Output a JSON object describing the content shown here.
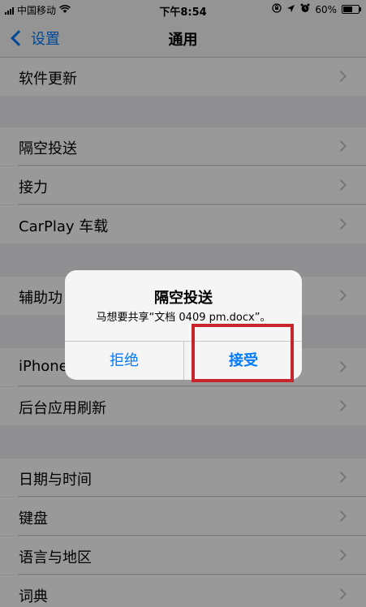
{
  "status_bar": {
    "carrier": "中国移动",
    "time": "下午8:54",
    "battery_percent": "60%",
    "battery_level": 0.6,
    "icons": [
      "signal-icon",
      "wifi-icon",
      "location-lock-icon",
      "location-icon",
      "alarm-icon",
      "battery-icon"
    ]
  },
  "nav": {
    "back_label": "设置",
    "title": "通用"
  },
  "settings": {
    "rows": [
      {
        "label": "软件更新"
      },
      {
        "label": "隔空投送"
      },
      {
        "label": "接力"
      },
      {
        "label": "CarPlay 车载"
      },
      {
        "label": "辅助功"
      },
      {
        "label": "iPhone"
      },
      {
        "label": "后台应用刷新"
      },
      {
        "label": "日期与时间"
      },
      {
        "label": "键盘"
      },
      {
        "label": "语言与地区"
      },
      {
        "label": "词典"
      }
    ]
  },
  "alert": {
    "title": "隔空投送",
    "message": "马想要共享“文档 0409 pm.docx”。",
    "decline_label": "拒绝",
    "accept_label": "接受",
    "accent_color": "#007aff",
    "highlight_color": "#c8242c"
  }
}
